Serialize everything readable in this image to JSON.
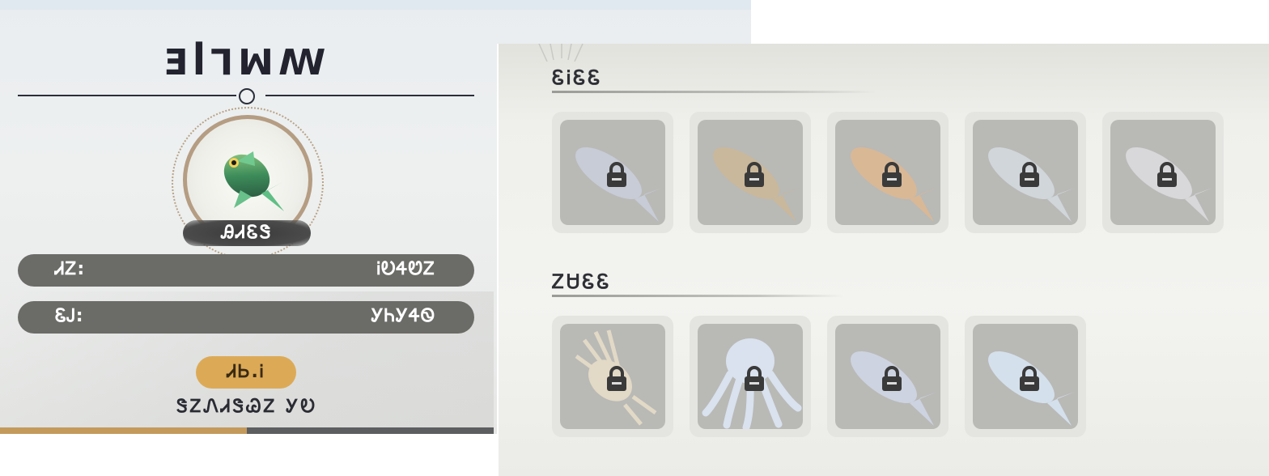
{
  "detail": {
    "fish_name": "ƎꟾꞀꟽꟿ",
    "rarity": "ᎯᏗᏋᏕ",
    "stats": [
      {
        "label": "ᏗᏃ:",
        "value": "ᎥᎧᏎᏬᏃ"
      },
      {
        "label": "ᏋᎫ:",
        "value": "ᎩᏂᎩᏎᏫ"
      }
    ],
    "level": "ᏗᏏ.Ꭵ",
    "xp_text": "ᏕᏃᏁᏗᏕᏊᏃ ᎩᎧ",
    "progress": 0.5,
    "colors": {
      "accent": "#dcaa57",
      "bar": "#6b6b67",
      "progress_fill": "#c49a5c"
    }
  },
  "collection": {
    "sections": [
      {
        "title": "ᏋᎥᏋᏋ",
        "items": [
          {
            "name": "cod-fish",
            "locked": true,
            "color": "#c7ccd6"
          },
          {
            "name": "flounder-fish",
            "locked": true,
            "color": "#c9b89b"
          },
          {
            "name": "red-snapper-fish",
            "locked": true,
            "color": "#d9b896"
          },
          {
            "name": "silver-fish",
            "locked": true,
            "color": "#d0d6da"
          },
          {
            "name": "mackerel-fish",
            "locked": true,
            "color": "#d8d8da"
          }
        ]
      },
      {
        "title": "ᏃᏌᏋᏋ",
        "items": [
          {
            "name": "lionfish",
            "locked": true,
            "color": "#e2d9c6"
          },
          {
            "name": "octopus",
            "locked": true,
            "color": "#d9e2ee"
          },
          {
            "name": "tuna-fish",
            "locked": true,
            "color": "#cdd3e0"
          },
          {
            "name": "pomfret-fish",
            "locked": true,
            "color": "#d4e0ec"
          }
        ]
      }
    ],
    "lock_icon": "padlock-icon"
  }
}
